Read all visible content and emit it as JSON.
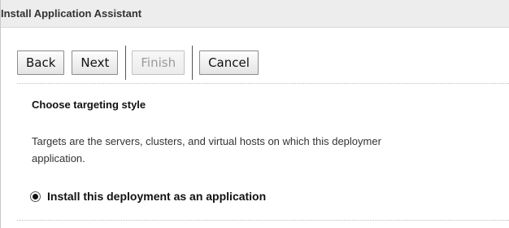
{
  "header": {
    "title": "Install Application Assistant"
  },
  "toolbar": {
    "back_label": "Back",
    "next_label": "Next",
    "finish_label": "Finish",
    "cancel_label": "Cancel"
  },
  "section": {
    "title": "Choose targeting style",
    "description_line1": "Targets are the servers, clusters, and virtual hosts on which this deploymer",
    "description_line2": "application."
  },
  "options": {
    "install_as_application": {
      "label": "Install this deployment as an application",
      "selected": true
    }
  }
}
